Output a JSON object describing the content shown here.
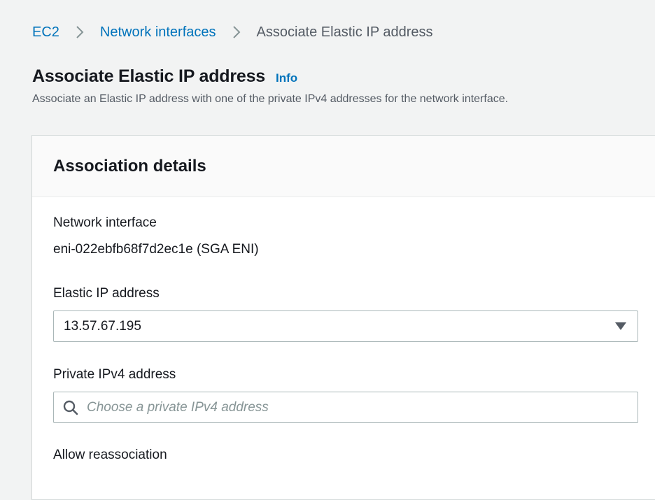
{
  "breadcrumb": {
    "items": [
      {
        "label": "EC2"
      },
      {
        "label": "Network interfaces"
      },
      {
        "label": "Associate Elastic IP address"
      }
    ]
  },
  "header": {
    "title": "Associate Elastic IP address",
    "info": "Info",
    "description": "Associate an Elastic IP address with one of the private IPv4 addresses for the network interface."
  },
  "panel": {
    "title": "Association details",
    "network_interface": {
      "label": "Network interface",
      "value": "eni-022ebfb68f7d2ec1e (SGA ENI)"
    },
    "elastic_ip": {
      "label": "Elastic IP address",
      "value": "13.57.67.195"
    },
    "private_ipv4": {
      "label": "Private IPv4 address",
      "placeholder": "Choose a private IPv4 address"
    },
    "reassociation": {
      "label": "Allow reassociation"
    }
  },
  "colors": {
    "link": "#0073bb",
    "background": "#f2f3f3"
  }
}
